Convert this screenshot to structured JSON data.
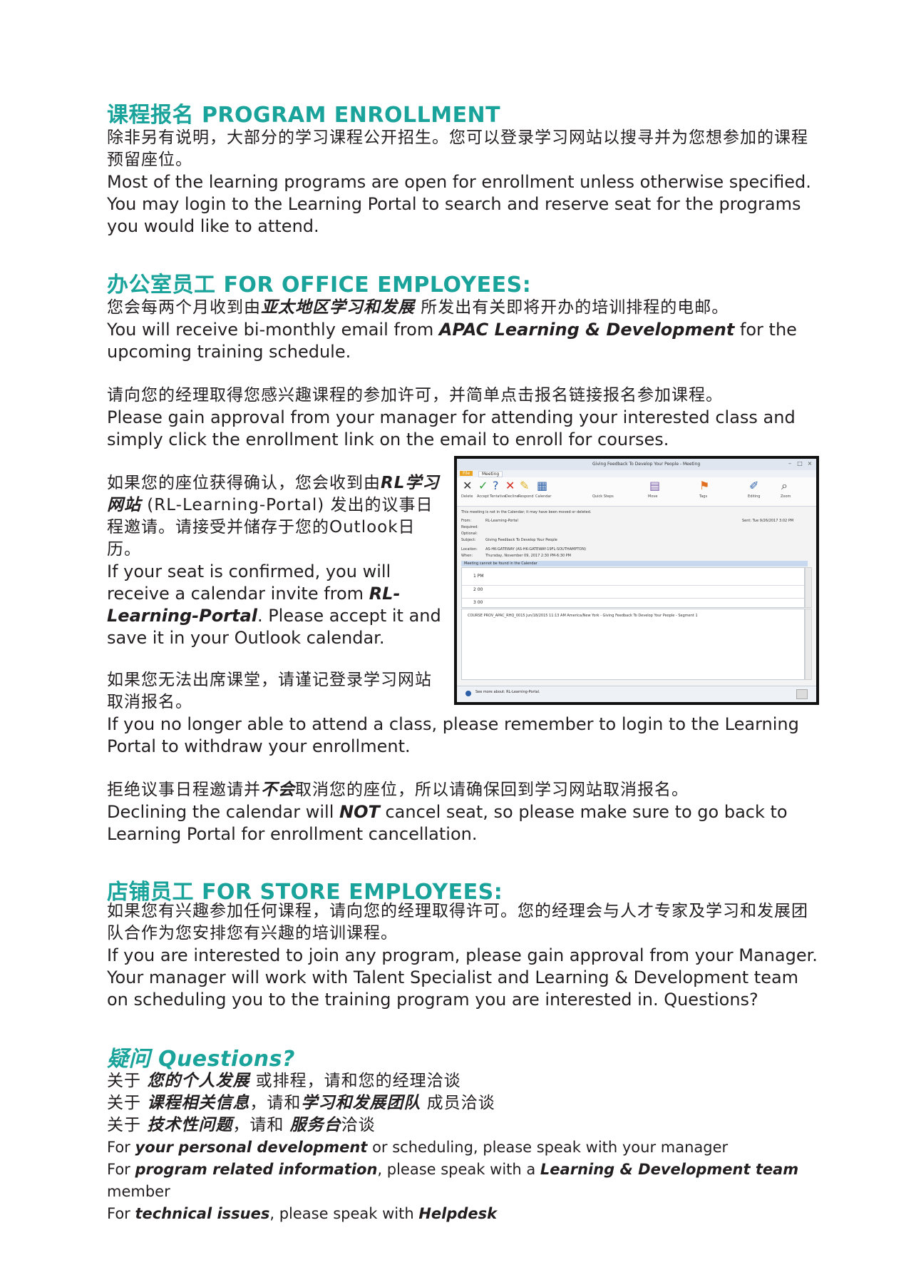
{
  "enrollment": {
    "heading": "课程报名 PROGRAM ENROLLMENT",
    "zh": "除非另有说明，大部分的学习课程公开招生。您可以登录学习网站以搜寻并为您想参加的课程预留座位。",
    "en": "Most of the learning programs are open for enrollment unless otherwise specified. You may login to the Learning Portal to search and reserve seat for the programs you would like to attend."
  },
  "office": {
    "heading": "办公室员工 FOR OFFICE EMPLOYEES:",
    "p1_zh_a": "您会每两个月收到由",
    "p1_zh_b": "亚太地区学习和发展",
    "p1_zh_c": " 所发出有关即将开办的培训排程的电邮。",
    "p1_en_a": "You will receive bi-monthly email from ",
    "p1_en_b": "APAC Learning & Development",
    "p1_en_c": " for the upcoming training schedule.",
    "p2_zh": "请向您的经理取得您感兴趣课程的参加许可，并简单点击报名链接报名参加课程。",
    "p2_en": "Please gain approval from your manager for attending your interested class and simply click the enrollment link on the email to enroll for courses.",
    "p3_zh_a": "如果您的座位获得确认，您会收到由",
    "p3_zh_b": "RL学习网站",
    "p3_zh_c": " (RL-Learning-Portal) 发出的议事日程邀请。请接受并储存于您的Outlook日历。",
    "p3_en_a": "If your seat is confirmed, you will receive a calendar invite from ",
    "p3_en_b": "RL-Learning-Portal",
    "p3_en_c": ". Please accept it and save it in your Outlook calendar.",
    "p4_zh": "如果您无法出席课堂，请谨记登录学习网站取消报名。",
    "p4_en": "If you no longer able to attend a class, please remember to login to the Learning Portal to withdraw your enrollment.",
    "p5_zh_a": "拒绝议事日程邀请并",
    "p5_zh_b": "不会",
    "p5_zh_c": "取消您的座位，所以请确保回到学习网站取消报名。",
    "p5_en_a": "Declining the calendar will ",
    "p5_en_b": "NOT",
    "p5_en_c": " cancel seat, so please make sure to go back to Learning Portal for enrollment cancellation."
  },
  "screenshot": {
    "window_title": "Giving Feedback To Develop Your People - Meeting",
    "tab_file": "File",
    "tab_meeting": "Meeting",
    "notice": "This meeting is not in the Calendar; it may have been moved or deleted.",
    "from_label": "From:",
    "from_value": "RL-Learning-Portal",
    "sent_value": "Sent:  Tue 9/26/2017 3:02 PM",
    "required_label": "Required:",
    "optional_label": "Optional:",
    "subject_label": "Subject:",
    "subject_value": "Giving Feedback To Develop Your People",
    "location_label": "Location:",
    "location_value": "AS-HK-GATEWAY (AS-HK-GATEWAY-19FL-SOUTHAMPTON)",
    "when_label": "When:",
    "when_value": "Thursday, November 09, 2017 2:30 PM-6:30 PM",
    "cal_notice": "Meeting cannot be found in the Calendar",
    "hours": [
      "1 PM",
      "2 00",
      "3 00"
    ],
    "body_line": "COURSE PROV_APAC_RHQ_0015 Jun/18/2015 11:13 AM America/New York - Giving Feedback To Develop Your People - Segment 1",
    "footer": "See more about: RL-Learning-Portal.",
    "ribbon_labels": [
      "Delete",
      "Accept",
      "Tentative",
      "Decline",
      "Respond",
      "Calendar",
      "Quick Steps",
      "Move",
      "Tags",
      "Editing",
      "Zoom"
    ]
  },
  "store": {
    "heading": "店铺员工 FOR STORE EMPLOYEES:",
    "zh": "如果您有兴趣参加任何课程，请向您的经理取得许可。您的经理会与人才专家及学习和发展团队合作为您安排您有兴趣的培训课程。",
    "en": "If you are interested to join any program, please gain approval from your Manager. Your manager will work with Talent Specialist and Learning & Development team on scheduling you to the training program you are interested in. Questions?"
  },
  "questions": {
    "heading": "疑问 Questions?",
    "zh1_a": "关于 ",
    "zh1_b": "您的个人发展",
    "zh1_c": " 或排程，请和您的经理洽谈",
    "zh2_a": "关于 ",
    "zh2_b": "课程相关信息",
    "zh2_c": "，请和",
    "zh2_d": "学习和发展团队",
    "zh2_e": " 成员洽谈",
    "zh3_a": "关于 ",
    "zh3_b": "技术性问题",
    "zh3_c": "，请和 ",
    "zh3_d": "服务台",
    "zh3_e": "洽谈",
    "en1_a": "For ",
    "en1_b": "your personal development",
    "en1_c": " or scheduling, please speak with your manager",
    "en2_a": "For ",
    "en2_b": "program related information",
    "en2_c": ", please speak with a ",
    "en2_d": "Learning & Development team",
    "en2_e": " member",
    "en3_a": "For ",
    "en3_b": "technical issues",
    "en3_c": ", please speak with ",
    "en3_d": "Helpdesk"
  }
}
